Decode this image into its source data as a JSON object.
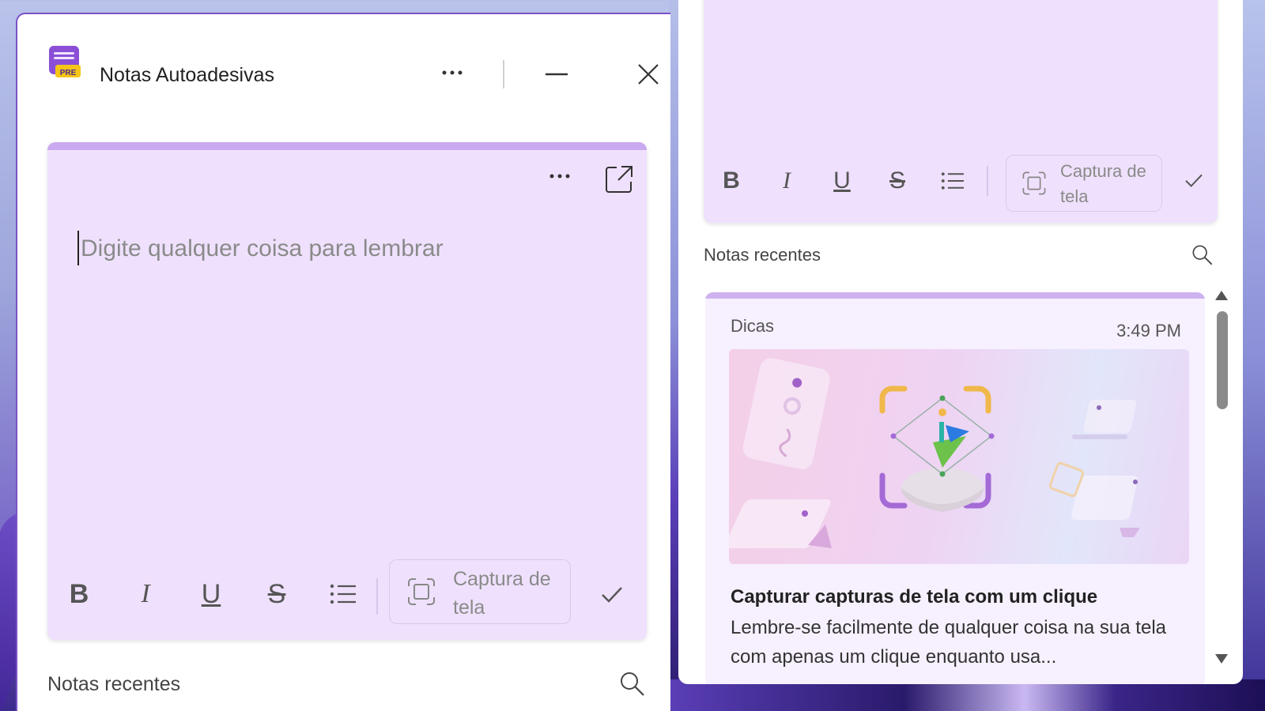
{
  "colors": {
    "accent": "#7b52c6",
    "note_bg": "#efe1fd",
    "note_topbar": "#c9a9ef",
    "app_icon_bg": "#8a4fd6",
    "app_icon_badge": "#f5c518"
  },
  "left_window": {
    "app_icon": "sticky-notes-icon",
    "app_icon_badge": "PRE",
    "title": "Notas Autoadesivas",
    "more_icon": "more-horizontal-icon",
    "minimize_icon": "minimize-icon",
    "close_icon": "close-icon",
    "note": {
      "more_icon": "more-horizontal-icon",
      "open_icon": "open-in-new-window-icon",
      "placeholder": "Digite qualquer coisa para lembrar",
      "toolbar": {
        "bold": "B",
        "italic": "I",
        "underline": "U",
        "strikethrough": "S",
        "list_icon": "bullet-list-icon",
        "capture_label": "Captura de tela",
        "capture_icon": "screenshot-icon",
        "confirm_icon": "checkmark-icon"
      }
    },
    "recent_label": "Notas recentes",
    "search_icon": "search-icon"
  },
  "right_window": {
    "toolbar": {
      "bold": "B",
      "italic": "I",
      "underline": "U",
      "strikethrough": "S",
      "list_icon": "bullet-list-icon",
      "capture_label": "Captura de tela",
      "capture_icon": "screenshot-icon",
      "confirm_icon": "checkmark-icon"
    },
    "recent_label": "Notas recentes",
    "search_icon": "search-icon",
    "tip_note": {
      "tag": "Dicas",
      "time": "3:49 PM",
      "image": "screenshot-tip-illustration",
      "title": "Capturar capturas de tela com um clique",
      "body": "Lembre-se facilmente de qualquer coisa na sua tela com apenas um clique enquanto usa..."
    }
  }
}
